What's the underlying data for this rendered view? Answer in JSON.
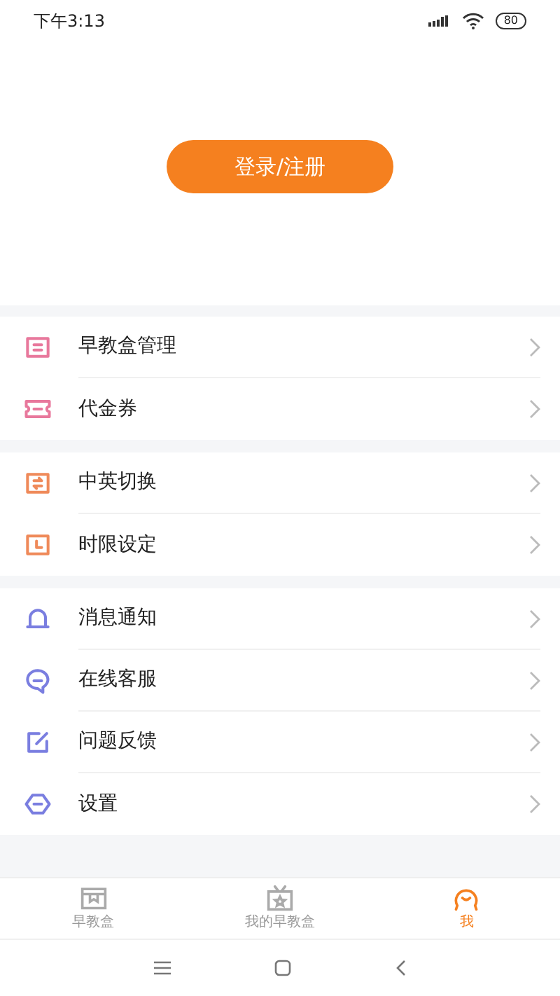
{
  "status_bar": {
    "time": "下午3:13",
    "battery": "80"
  },
  "login_button": "登录/注册",
  "menu_groups": [
    {
      "items": [
        {
          "label": "早教盒管理",
          "color": "#e8789c"
        },
        {
          "label": "代金券",
          "color": "#e8789c"
        }
      ]
    },
    {
      "items": [
        {
          "label": "中英切换",
          "color": "#ef8a5a"
        },
        {
          "label": "时限设定",
          "color": "#ef8a5a"
        }
      ]
    },
    {
      "items": [
        {
          "label": "消息通知",
          "color": "#7a7ee0"
        },
        {
          "label": "在线客服",
          "color": "#7a7ee0"
        },
        {
          "label": "问题反馈",
          "color": "#7a7ee0"
        },
        {
          "label": "设置",
          "color": "#7a7ee0"
        }
      ]
    }
  ],
  "tab_bar": [
    {
      "label": "早教盒",
      "selected": false
    },
    {
      "label": "我的早教盒",
      "selected": false
    },
    {
      "label": "我",
      "selected": true
    }
  ]
}
